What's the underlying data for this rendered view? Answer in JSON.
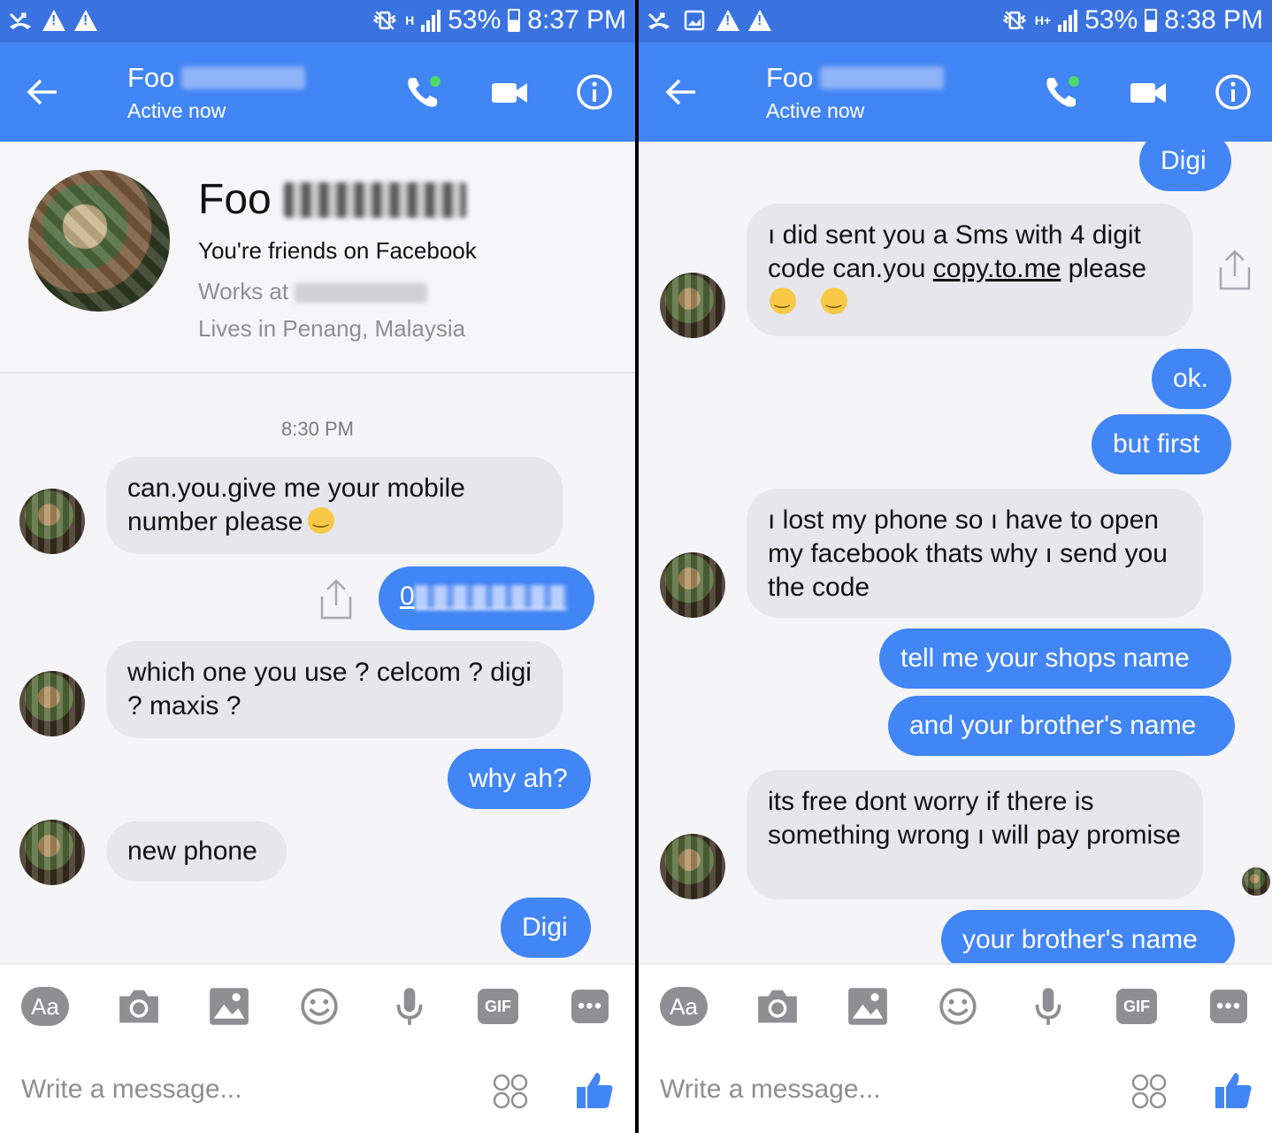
{
  "left": {
    "status": {
      "battery": "53%",
      "time": "8:37 PM",
      "network": "H"
    },
    "header": {
      "name_visible": "Foo",
      "active": "Active now"
    },
    "profile": {
      "name_visible": "Foo",
      "friends": "You're friends on Facebook",
      "works_prefix": "Works at",
      "lives": "Lives in Penang, Malaysia"
    },
    "timestamp": "8:30 PM",
    "messages": [
      {
        "from": "them",
        "text": "can.you.give me your mobile number please",
        "emoji": "smile"
      },
      {
        "from": "me",
        "text_visible": "0",
        "note": "phone number redacted"
      },
      {
        "from": "them",
        "text": "which one you use ? celcom ? digi ? maxis ?"
      },
      {
        "from": "me",
        "text": "why ah?"
      },
      {
        "from": "them",
        "text": "new phone"
      },
      {
        "from": "me",
        "text": "Digi"
      }
    ],
    "composer": {
      "aa": "Aa",
      "gif": "GIF",
      "more": "•••",
      "placeholder": "Write a message..."
    }
  },
  "right": {
    "status": {
      "battery": "53%",
      "time": "8:38 PM",
      "network": "H+"
    },
    "header": {
      "name_visible": "Foo",
      "active": "Active now"
    },
    "messages": [
      {
        "from": "me",
        "text": "Digi"
      },
      {
        "from": "them",
        "text_1": "ı did sent you a Sms with 4 digit",
        "text_2a": "code can.you ",
        "text_2b": "copy.to.me",
        "text_2c": " please",
        "emoji": "smile"
      },
      {
        "from": "me",
        "text": "ok."
      },
      {
        "from": "me",
        "text": "but first"
      },
      {
        "from": "them",
        "text": "ı lost my phone so ı have to open my facebook thats why ı send you the code"
      },
      {
        "from": "me",
        "text": "tell me your shops name"
      },
      {
        "from": "me",
        "text": "and your brother's name"
      },
      {
        "from": "them",
        "text": "its free dont worry if there is something wrong ı will pay promise"
      },
      {
        "from": "me",
        "text": "your brother's name"
      }
    ],
    "composer": {
      "aa": "Aa",
      "gif": "GIF",
      "more": "•••",
      "placeholder": "Write a message..."
    }
  },
  "colors": {
    "header": "#4285f4",
    "statusbar": "#3a73e0",
    "outgoing": "#4285f4",
    "incoming": "#e6e6eb",
    "call_dot": "#4cd964"
  }
}
